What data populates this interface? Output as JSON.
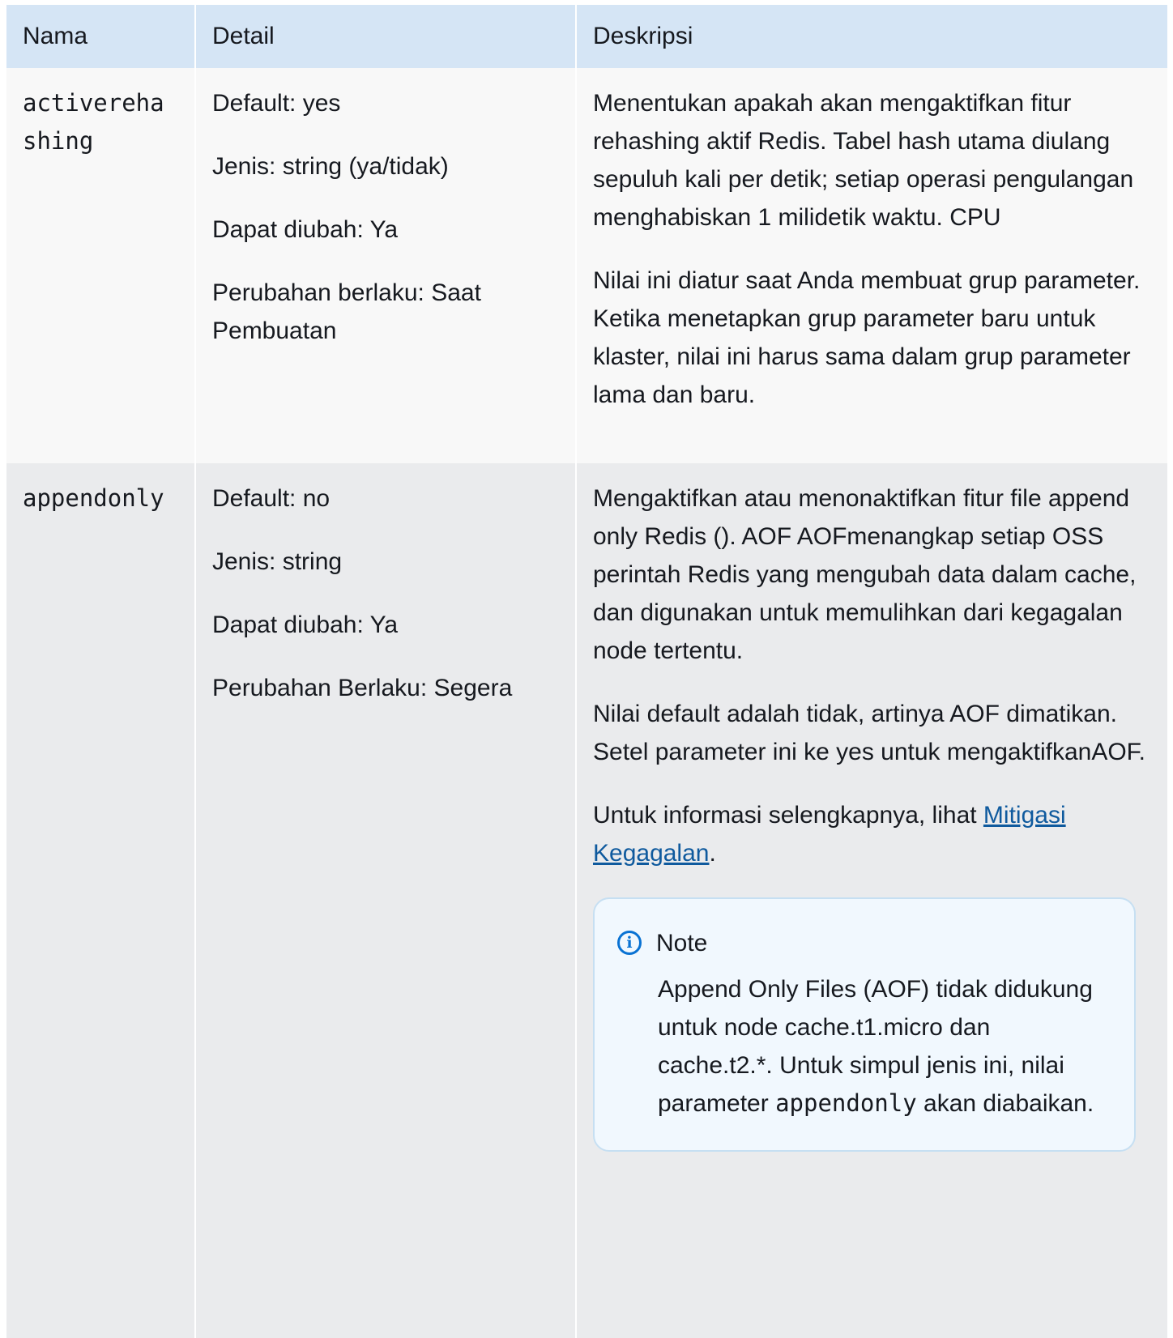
{
  "header": {
    "col_name": "Nama",
    "col_detail": "Detail",
    "col_desc": "Deskripsi"
  },
  "rows": [
    {
      "name": "activerehashing",
      "details": [
        "Default: yes",
        "Jenis: string (ya/tidak)",
        "Dapat diubah: Ya",
        "Perubahan berlaku: Saat Pembuatan"
      ],
      "desc": [
        "Menentukan apakah akan mengaktifkan fitur rehashing aktif Redis. Tabel hash utama diulang sepuluh kali per detik; setiap operasi pengulangan menghabiskan 1 milidetik waktu. CPU",
        "Nilai ini diatur saat Anda membuat grup parameter. Ketika menetapkan grup parameter baru untuk klaster, nilai ini harus sama dalam grup parameter lama dan baru."
      ]
    },
    {
      "name": "appendonly",
      "details": [
        "Default: no",
        "Jenis: string",
        "Dapat diubah: Ya",
        "Perubahan Berlaku: Segera"
      ],
      "desc": [
        "Mengaktifkan atau menonaktifkan fitur file append only Redis (). AOF AOFmenangkap setiap OSS perintah Redis yang mengubah data dalam cache, dan digunakan untuk memulihkan dari kegagalan node tertentu.",
        "Nilai default adalah tidak, artinya AOF dimatikan. Setel parameter ini ke yes untuk mengaktifkanAOF."
      ],
      "more_info_prefix": "Untuk informasi selengkapnya, lihat ",
      "more_info_link": "Mitigasi Kegagalan",
      "more_info_suffix": ".",
      "note": {
        "title": "Note",
        "icon": "info-icon",
        "text_before": "Append Only Files (AOF) tidak didukung untuk node cache.t1.micro dan cache.t2.*. Untuk simpul jenis ini, nilai parameter ",
        "code": "appendonly",
        "text_after": " akan diabaikan."
      }
    }
  ]
}
